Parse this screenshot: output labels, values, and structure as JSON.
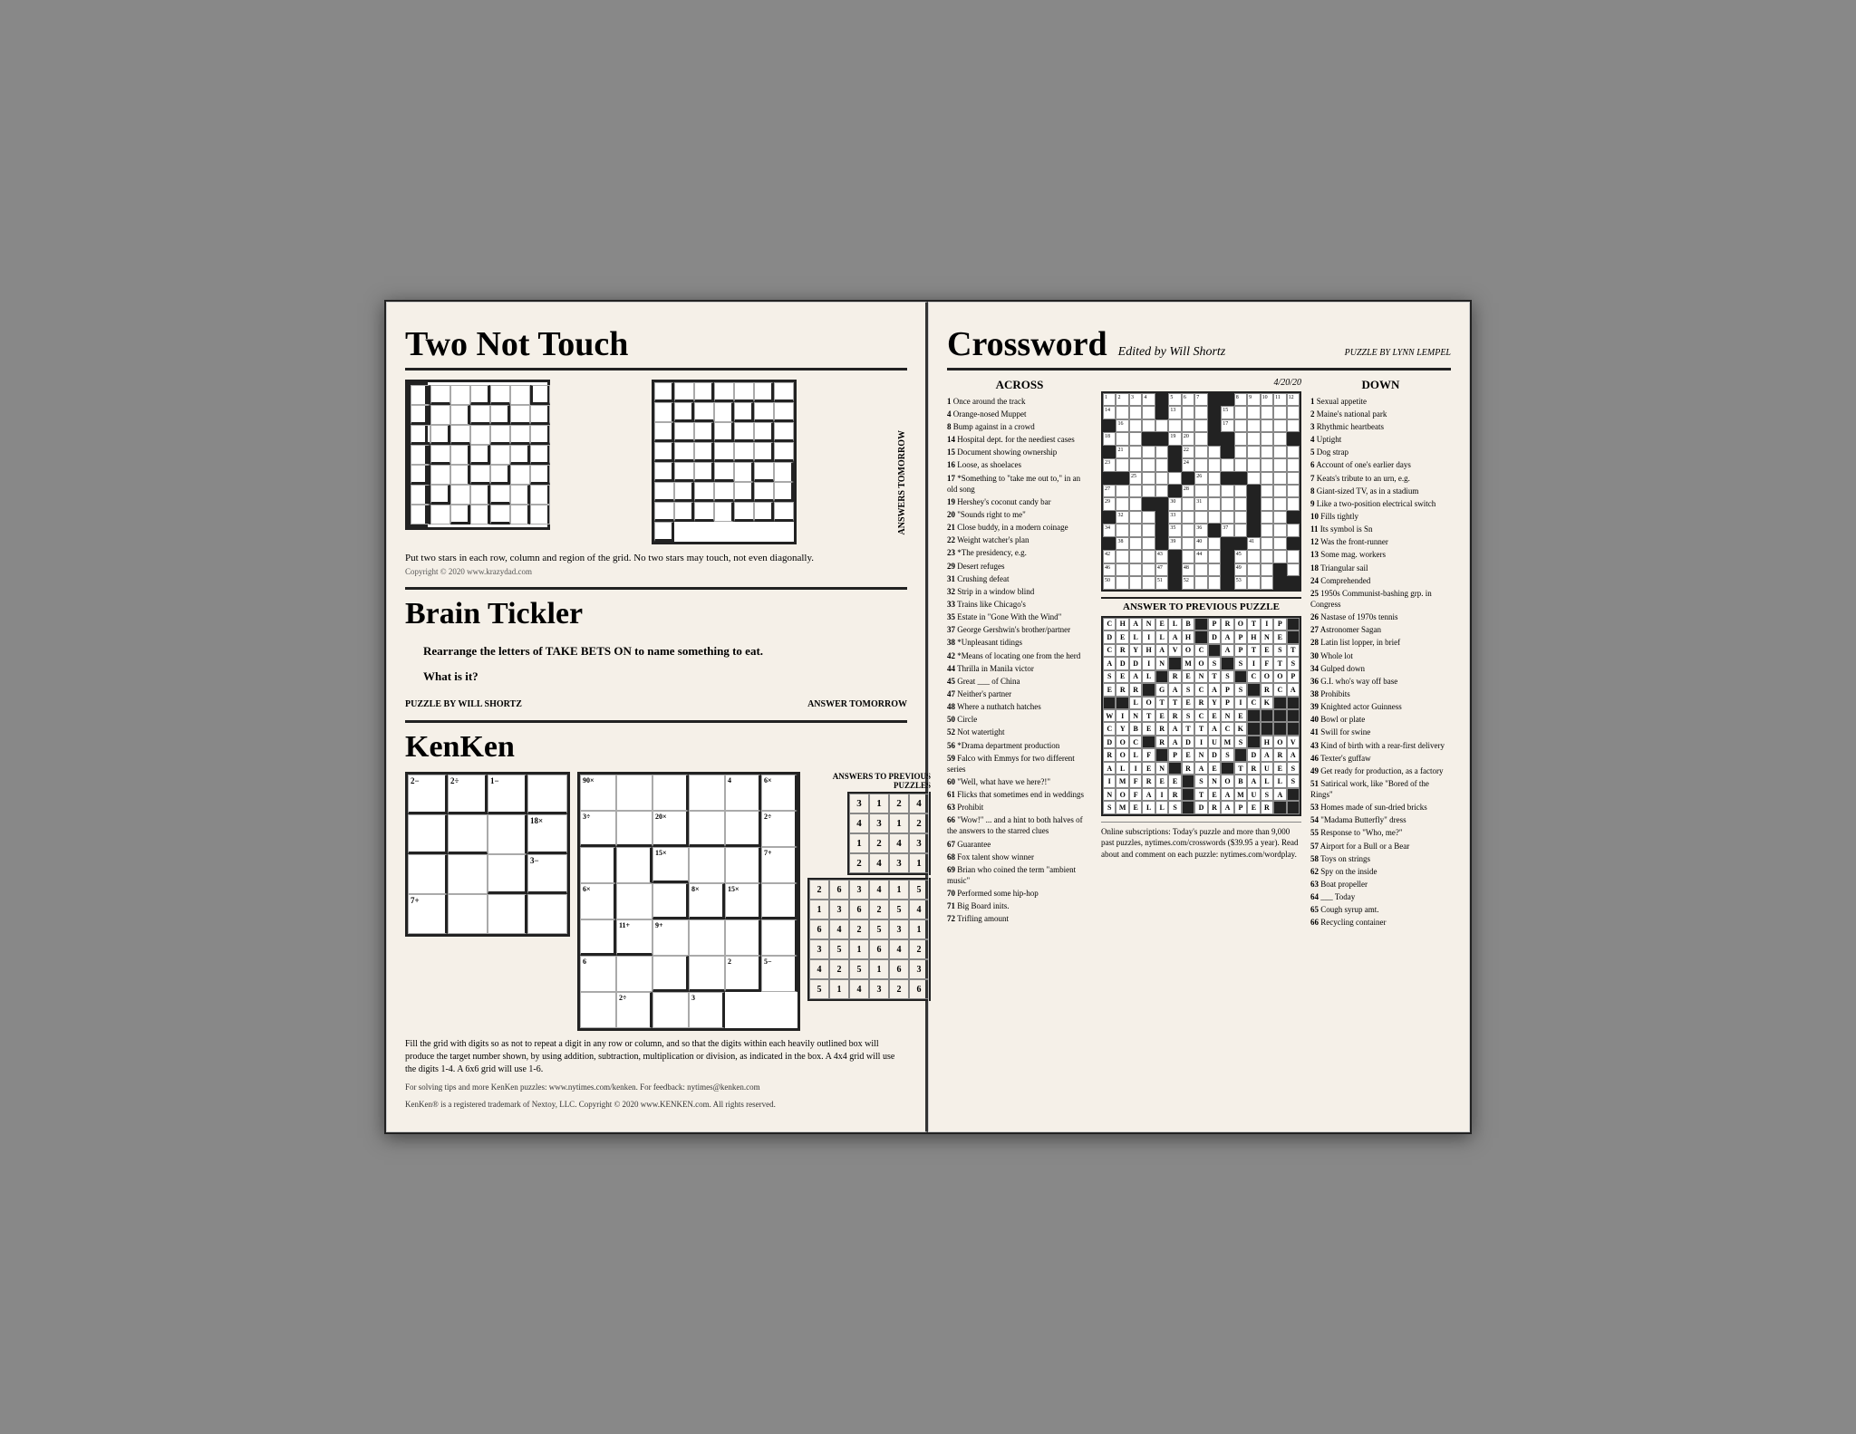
{
  "left": {
    "tnt_title": "Two Not Touch",
    "tnt_instructions": "Put two stars in each row, column and region of the grid. No two stars may touch, not even diagonally.",
    "tnt_copyright": "Copyright © 2020 www.krazydad.com",
    "answers_tomorrow": "ANSWERS TOMORROW",
    "brain_title": "Brain Tickler",
    "brain_q1": "Rearrange the letters of TAKE BETS ON to name something to eat.",
    "brain_q2": "What is it?",
    "brain_puzzle_by": "PUZZLE BY WILL SHORTZ",
    "brain_answer": "ANSWER TOMORROW",
    "kenken_title": "KenKen",
    "kenken_instructions": "Fill the grid with digits so as not to repeat a digit in any row or column, and so that the digits within each heavily outlined box will produce the target number shown, by using addition, subtraction, multiplication or division, as indicated in the box. A 4x4 grid will use the digits 1-4. A 6x6 grid will use 1-6.",
    "kenken_tips": "For solving tips and more KenKen puzzles: www.nytimes.com/kenken. For feedback: nytimes@kenken.com",
    "kenken_trademark": "KenKen® is a registered trademark of Nextoy, LLC. Copyright © 2020 www.KENKEN.com. All rights reserved.",
    "kenken_answers_to": "ANSWERS TO PREVIOUS PUZZLES",
    "kenken_prev_4x4": [
      [
        "3",
        "1",
        "2",
        "4"
      ],
      [
        "4",
        "3",
        "1",
        "2"
      ],
      [
        "1",
        "2",
        "4",
        "3"
      ],
      [
        "2",
        "4",
        "3",
        "1"
      ]
    ],
    "kenken_prev_6x6": [
      [
        "2",
        "6",
        "3",
        "4",
        "1",
        "5"
      ],
      [
        "1",
        "3",
        "6",
        "2",
        "5",
        "4"
      ],
      [
        "6",
        "4",
        "2",
        "5",
        "3",
        "1"
      ],
      [
        "3",
        "5",
        "1",
        "6",
        "4",
        "2"
      ],
      [
        "4",
        "2",
        "5",
        "1",
        "6",
        "3"
      ],
      [
        "5",
        "1",
        "4",
        "3",
        "2",
        "6"
      ]
    ]
  },
  "right": {
    "cw_title": "Crossword",
    "cw_editor": "Edited by Will Shortz",
    "cw_byline": "PUZZLE BY LYNN LEMPEL",
    "cw_date": "4/20/20",
    "across_label": "ACROSS",
    "down_label": "DOWN",
    "across_clues": [
      {
        "num": "1",
        "clue": "Once around the track"
      },
      {
        "num": "4",
        "clue": "Orange-nosed Muppet"
      },
      {
        "num": "8",
        "clue": "Bump against in a crowd"
      },
      {
        "num": "14",
        "clue": "Hospital dept. for the neediest cases"
      },
      {
        "num": "15",
        "clue": "Document showing ownership"
      },
      {
        "num": "16",
        "clue": "Loose, as shoelaces"
      },
      {
        "num": "17",
        "clue": "*Something to \"take me out to,\" in an old song"
      },
      {
        "num": "19",
        "clue": "Hershey's coconut candy bar"
      },
      {
        "num": "20",
        "clue": "\"Sounds right to me\""
      },
      {
        "num": "21",
        "clue": "Close buddy, in a modern coinage"
      },
      {
        "num": "22",
        "clue": "Weight watcher's plan"
      },
      {
        "num": "23",
        "clue": "*The presidency, e.g."
      },
      {
        "num": "29",
        "clue": "Desert refuges"
      },
      {
        "num": "31",
        "clue": "Crushing defeat"
      },
      {
        "num": "32",
        "clue": "Strip in a window blind"
      },
      {
        "num": "33",
        "clue": "Trains like Chicago's"
      },
      {
        "num": "35",
        "clue": "Estate in \"Gone With the Wind\""
      },
      {
        "num": "37",
        "clue": "George Gershwin's brother/partner"
      },
      {
        "num": "38",
        "clue": "*Unpleasant tidings"
      },
      {
        "num": "42",
        "clue": "*Means of locating one from the herd"
      },
      {
        "num": "44",
        "clue": "Thrilla in Manila victor"
      },
      {
        "num": "45",
        "clue": "Great ___ of China"
      },
      {
        "num": "47",
        "clue": "Neither's partner"
      },
      {
        "num": "48",
        "clue": "Where a nuthatch hatches"
      },
      {
        "num": "50",
        "clue": "Circle"
      },
      {
        "num": "52",
        "clue": "Not watertight"
      },
      {
        "num": "56",
        "clue": "*Drama department production"
      },
      {
        "num": "59",
        "clue": "Falco with Emmys for two different series"
      },
      {
        "num": "60",
        "clue": "\"Well, what have we here?!\""
      },
      {
        "num": "61",
        "clue": "Flicks that sometimes end in weddings"
      },
      {
        "num": "63",
        "clue": "Prohibit"
      },
      {
        "num": "66",
        "clue": "\"Wow!\" ... and a hint to both halves of the answers to the starred clues"
      },
      {
        "num": "67",
        "clue": "Guarantee"
      },
      {
        "num": "68",
        "clue": "Fox talent show winner"
      },
      {
        "num": "69",
        "clue": "Brian who coined the term \"ambient music\""
      },
      {
        "num": "70",
        "clue": "Performed some hip-hop"
      },
      {
        "num": "71",
        "clue": "Big Board inits."
      },
      {
        "num": "72",
        "clue": "Trifling amount"
      }
    ],
    "down_clues": [
      {
        "num": "1",
        "clue": "Sexual appetite"
      },
      {
        "num": "2",
        "clue": "Maine's national park"
      },
      {
        "num": "3",
        "clue": "Rhythmic heartbeats"
      },
      {
        "num": "4",
        "clue": "Uptight"
      },
      {
        "num": "5",
        "clue": "Dog strap"
      },
      {
        "num": "6",
        "clue": "Account of one's earlier days"
      },
      {
        "num": "7",
        "clue": "Keats's tribute to an urn, e.g."
      },
      {
        "num": "8",
        "clue": "Giant-sized TV, as in a stadium"
      },
      {
        "num": "9",
        "clue": "Like a two-position electrical switch"
      },
      {
        "num": "10",
        "clue": "Fills tightly"
      },
      {
        "num": "11",
        "clue": "Its symbol is Sn"
      },
      {
        "num": "12",
        "clue": "Was the front-runner"
      },
      {
        "num": "13",
        "clue": "Some mag. workers"
      },
      {
        "num": "18",
        "clue": "Triangular sail"
      },
      {
        "num": "24",
        "clue": "Comprehended"
      },
      {
        "num": "25",
        "clue": "1950s Communist-bashing grp. in Congress"
      },
      {
        "num": "26",
        "clue": "Nastase of 1970s tennis"
      },
      {
        "num": "27",
        "clue": "Astronomer Sagan"
      },
      {
        "num": "28",
        "clue": "Latin list lopper, in brief"
      },
      {
        "num": "30",
        "clue": "Whole lot"
      },
      {
        "num": "34",
        "clue": "Gulped down"
      },
      {
        "num": "36",
        "clue": "G.I. who's way off base"
      },
      {
        "num": "38",
        "clue": "Prohibits"
      },
      {
        "num": "39",
        "clue": "Knighted actor Guinness"
      },
      {
        "num": "40",
        "clue": "Bowl or plate"
      },
      {
        "num": "41",
        "clue": "Swill for swine"
      },
      {
        "num": "43",
        "clue": "Kind of birth with a rear-first delivery"
      },
      {
        "num": "46",
        "clue": "Texter's guffaw"
      },
      {
        "num": "49",
        "clue": "Get ready for production, as a factory"
      },
      {
        "num": "51",
        "clue": "Satirical work, like \"Bored of the Rings\""
      },
      {
        "num": "53",
        "clue": "Homes made of sun-dried bricks"
      },
      {
        "num": "54",
        "clue": "\"Madama Butterfly\" dress"
      },
      {
        "num": "55",
        "clue": "Response to \"Who, me?\""
      },
      {
        "num": "57",
        "clue": "Airport for a Bull or a Bear"
      },
      {
        "num": "58",
        "clue": "Toys on strings"
      },
      {
        "num": "62",
        "clue": "Spy on the inside"
      },
      {
        "num": "63",
        "clue": "Boat propeller"
      },
      {
        "num": "64",
        "clue": "___ Today"
      },
      {
        "num": "65",
        "clue": "Cough syrup amt."
      },
      {
        "num": "66",
        "clue": "Recycling container"
      }
    ],
    "answer_prev_title": "ANSWER TO PREVIOUS PUZZLE",
    "answer_grid": [
      [
        "C",
        "H",
        "A",
        "N",
        "E",
        "L",
        "B",
        "",
        "P",
        "R",
        "O",
        "T",
        "I",
        "P",
        ""
      ],
      [
        "D",
        "E",
        "L",
        "I",
        "L",
        "A",
        "H",
        "",
        "D",
        "A",
        "P",
        "H",
        "N",
        "E",
        ""
      ],
      [
        "C",
        "R",
        "Y",
        "H",
        "A",
        "V",
        "O",
        "C",
        "",
        "A",
        "P",
        "T",
        "E",
        "S",
        "T"
      ],
      [
        "A",
        "D",
        "D",
        "I",
        "N",
        "",
        "M",
        "O",
        "S",
        "",
        "S",
        "I",
        "F",
        "T",
        "S"
      ],
      [
        "S",
        "E",
        "A",
        "L",
        "",
        "R",
        "E",
        "N",
        "T",
        "S",
        "",
        "C",
        "O",
        "O",
        "P"
      ],
      [
        "E",
        "R",
        "R",
        "",
        "G",
        "A",
        "S",
        "C",
        "A",
        "P",
        "S",
        "",
        "R",
        "C",
        "A"
      ],
      [
        "",
        "",
        "L",
        "O",
        "T",
        "T",
        "E",
        "R",
        "Y",
        "P",
        "I",
        "C",
        "K",
        "",
        ""
      ],
      [
        "W",
        "I",
        "N",
        "T",
        "E",
        "R",
        "S",
        "C",
        "E",
        "N",
        "E",
        "",
        "",
        "",
        ""
      ],
      [
        "C",
        "Y",
        "B",
        "E",
        "R",
        "A",
        "T",
        "T",
        "A",
        "C",
        "K",
        "",
        "",
        "",
        ""
      ],
      [
        "D",
        "O",
        "C",
        "",
        "R",
        "A",
        "D",
        "I",
        "U",
        "M",
        "S",
        "",
        "H",
        "O",
        "V"
      ],
      [
        "R",
        "O",
        "L",
        "F",
        "",
        "P",
        "E",
        "N",
        "D",
        "S",
        "",
        "D",
        "A",
        "R",
        "A"
      ],
      [
        "A",
        "L",
        "I",
        "E",
        "N",
        "",
        "R",
        "A",
        "E",
        "",
        "T",
        "R",
        "U",
        "E",
        "S"
      ],
      [
        "I",
        "M",
        "F",
        "R",
        "E",
        "E",
        "",
        "S",
        "N",
        "O",
        "B",
        "A",
        "L",
        "L",
        "S"
      ],
      [
        "N",
        "O",
        "F",
        "A",
        "I",
        "R",
        "",
        "T",
        "E",
        "A",
        "M",
        "U",
        "S",
        "A",
        ""
      ],
      [
        "S",
        "M",
        "E",
        "L",
        "L",
        "S",
        "",
        "D",
        "R",
        "A",
        "P",
        "E",
        "R",
        "",
        ""
      ]
    ],
    "online_info": "Online subscriptions: Today's puzzle and more than 9,000 past puzzles, nytimes.com/crosswords ($39.95 a year).\nRead about and comment on each puzzle: nytimes.com/wordplay."
  }
}
